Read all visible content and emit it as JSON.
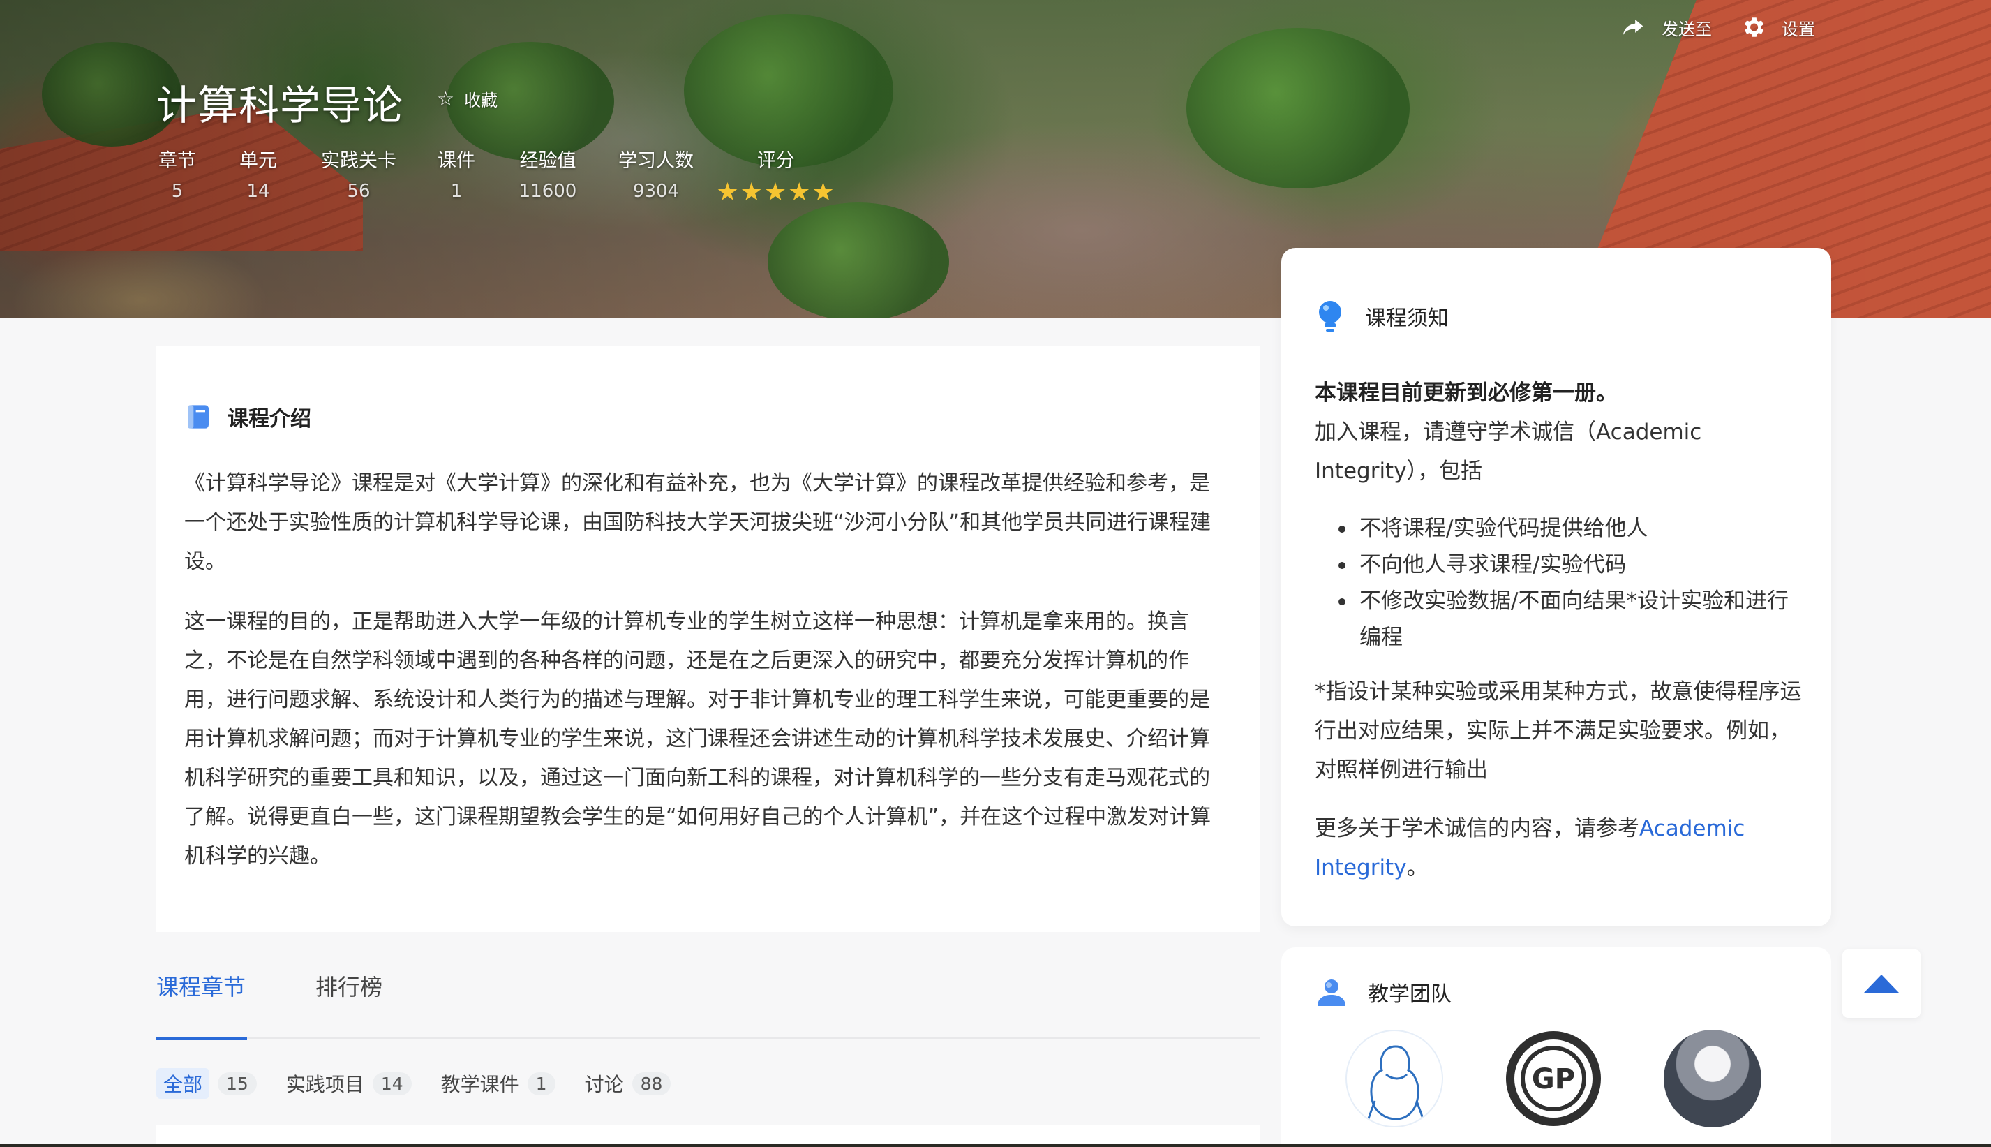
{
  "course": {
    "title": "计算科学导论",
    "favorite_label": "收藏",
    "rating_stars": 5
  },
  "header_actions": {
    "send_label": "发送至",
    "settings_label": "设置"
  },
  "stats": [
    {
      "label": "章节",
      "value": "5"
    },
    {
      "label": "单元",
      "value": "14"
    },
    {
      "label": "实践关卡",
      "value": "56"
    },
    {
      "label": "课件",
      "value": "1"
    },
    {
      "label": "经验值",
      "value": "11600"
    },
    {
      "label": "学习人数",
      "value": "9304"
    },
    {
      "label": "评分",
      "value": "★★★★★"
    }
  ],
  "intro": {
    "heading": "课程介绍",
    "paragraphs": [
      "《计算科学导论》课程是对《大学计算》的深化和有益补充，也为《大学计算》的课程改革提供经验和参考，是一个还处于实验性质的计算机科学导论课，由国防科技大学天河拔尖班“沙河小分队”和其他学员共同进行课程建设。",
      "这一课程的目的，正是帮助进入大学一年级的计算机专业的学生树立这样一种思想：计算机是拿来用的。换言之，不论是在自然学科领域中遇到的各种各样的问题，还是在之后更深入的研究中，都要充分发挥计算机的作用，进行问题求解、系统设计和人类行为的描述与理解。对于非计算机专业的理工科学生来说，可能更重要的是用计算机求解问题；而对于计算机专业的学生来说，这门课程还会讲述生动的计算机科学技术发展史、介绍计算机科学研究的重要工具和知识，以及，通过这一门面向新工科的课程，对计算机科学的一些分支有走马观花式的了解。说得更直白一些，这门课程期望教会学生的是“如何用好自己的个人计算机”，并在这个过程中激发对计算机科学的兴趣。"
    ]
  },
  "tabs": [
    {
      "label": "课程章节",
      "active": true
    },
    {
      "label": "排行榜",
      "active": false
    }
  ],
  "filters": [
    {
      "label": "全部",
      "count": "15",
      "active": true
    },
    {
      "label": "实践项目",
      "count": "14",
      "active": false
    },
    {
      "label": "教学课件",
      "count": "1",
      "active": false
    },
    {
      "label": "讨论",
      "count": "88",
      "active": false
    }
  ],
  "notice": {
    "heading": "课程须知",
    "bold_line": "本课程目前更新到必修第一册。",
    "intro_line": "加入课程，请遵守学术诚信（Academic Integrity），包括",
    "rules": [
      "不将课程/实验代码提供给他人",
      "不向他人寻求课程/实验代码",
      "不修改实验数据/不面向结果*设计实验和进行编程"
    ],
    "footnote": "*指设计某种实验或采用某种方式，故意使得程序运行出对应结果，实际上并不满足实验要求。例如，对照样例进行输出",
    "more_prefix": "更多关于学术诚信的内容，请参考",
    "more_link": "Academic Integrity",
    "more_suffix": "。"
  },
  "team": {
    "heading": "教学团队",
    "avatar2_text": "GP"
  },
  "colors": {
    "accent": "#2a6ad8",
    "star": "#f6c431",
    "page_bg": "#f7f7f8"
  },
  "icons": {
    "favorite": "star-outline-icon",
    "send": "share-arrow-icon",
    "settings": "gear-icon",
    "intro": "book-icon",
    "notice": "lightbulb-icon",
    "team": "user-icon",
    "back_to_top": "triangle-up-icon"
  }
}
